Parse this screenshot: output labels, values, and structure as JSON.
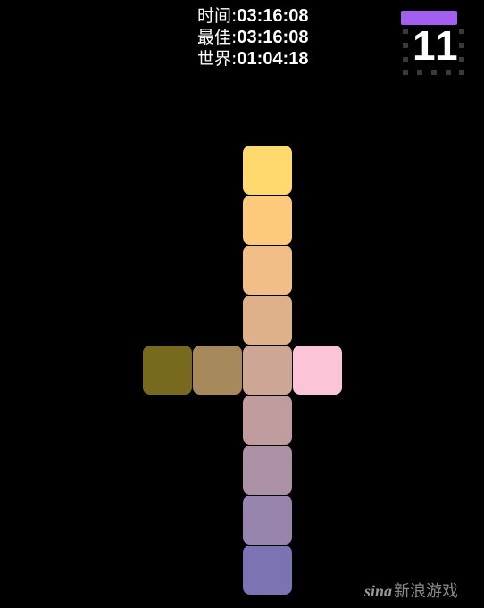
{
  "hud": {
    "time_label": "时间:",
    "time_value": "03:16:08",
    "best_label": "最佳:",
    "best_value": "03:16:08",
    "world_label": "世界:",
    "world_value": "01:04:18",
    "level_number": "11",
    "level_bar_color": "#a25ff0"
  },
  "board": {
    "tiles": [
      {
        "col": 2,
        "row": 0,
        "color": "#ffd86e"
      },
      {
        "col": 2,
        "row": 1,
        "color": "#fdc97a"
      },
      {
        "col": 2,
        "row": 2,
        "color": "#f1be87"
      },
      {
        "col": 2,
        "row": 3,
        "color": "#dfb18b"
      },
      {
        "col": 0,
        "row": 4,
        "color": "#776a1f"
      },
      {
        "col": 1,
        "row": 4,
        "color": "#a68a5c"
      },
      {
        "col": 2,
        "row": 4,
        "color": "#cda696"
      },
      {
        "col": 3,
        "row": 4,
        "color": "#fcc5d7"
      },
      {
        "col": 2,
        "row": 5,
        "color": "#c09c9f"
      },
      {
        "col": 2,
        "row": 6,
        "color": "#ac91a5"
      },
      {
        "col": 2,
        "row": 7,
        "color": "#9885ae"
      },
      {
        "col": 2,
        "row": 8,
        "color": "#7b73b2"
      }
    ]
  },
  "watermark": {
    "brand": "sina",
    "text": "新浪游戏"
  }
}
